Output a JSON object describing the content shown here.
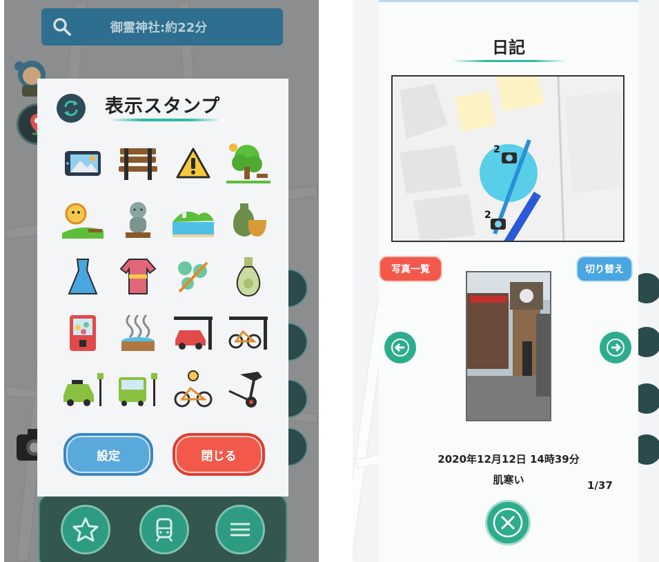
{
  "left": {
    "search": {
      "text": "御霊神社:約22分",
      "icon": "search-icon"
    },
    "dialog": {
      "title": "表示スタンプ",
      "refresh_icon": "refresh-icon",
      "stamps": [
        "photo-frame-stamp",
        "bench-stamp",
        "warning-sign-stamp",
        "tree-stamp",
        "sunny-park-stamp",
        "jizo-statue-stamp",
        "seaside-landscape-stamp",
        "pottery-stamp",
        "dress-stamp",
        "kimono-stamp",
        "candy-flowers-stamp",
        "vase-stamp",
        "gachapon-stamp",
        "hot-spring-stamp",
        "car-parking-stamp",
        "bicycle-parking-stamp",
        "taxi-stop-stamp",
        "bus-stop-stamp",
        "bicycle-coin-stamp",
        "segway-stamp"
      ],
      "settings_label": "設定",
      "close_label": "閉じる"
    },
    "nav": {
      "icons": [
        "star-icon",
        "train-icon",
        "menu-icon"
      ]
    },
    "colors": {
      "accent": "#2db8a6",
      "search_bg": "#2e6e8e",
      "settings": "#5aa9dc",
      "close": "#f2594a"
    }
  },
  "right": {
    "diary": {
      "title": "日記",
      "photos_button": "写真一覧",
      "switch_button": "切り替え",
      "map_marker_counts": [
        "2",
        "2"
      ],
      "datetime": "2020年12月12日 14時39分",
      "memo": "肌寒い",
      "counter": "1/37",
      "prev_icon": "arrow-left-icon",
      "next_icon": "arrow-right-icon",
      "close_icon": "close-icon"
    }
  }
}
